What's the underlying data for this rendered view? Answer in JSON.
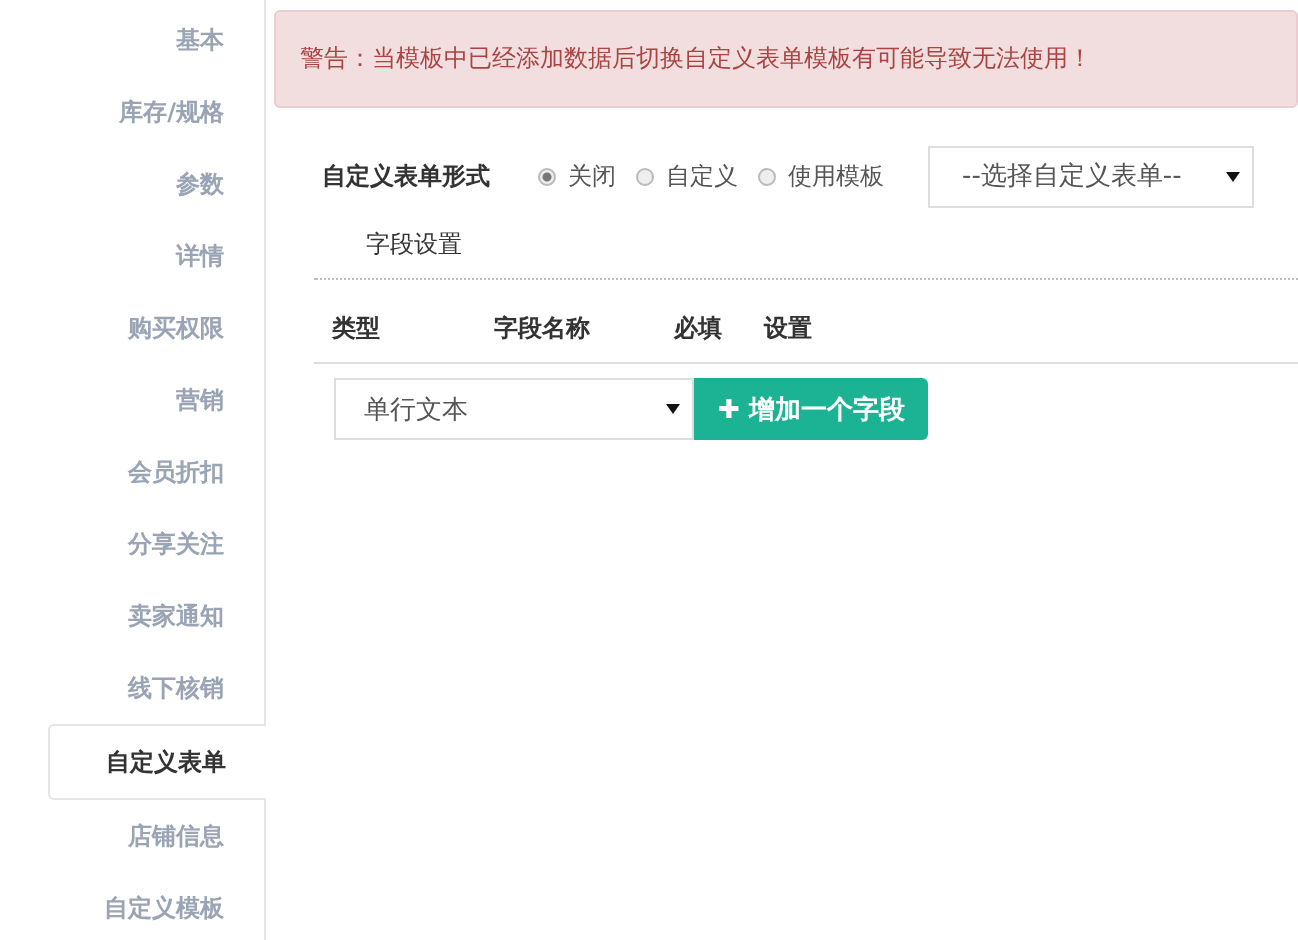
{
  "sidebar": {
    "items": [
      {
        "label": "基本",
        "selected": false
      },
      {
        "label": "库存/规格",
        "selected": false
      },
      {
        "label": "参数",
        "selected": false
      },
      {
        "label": "详情",
        "selected": false
      },
      {
        "label": "购买权限",
        "selected": false
      },
      {
        "label": "营销",
        "selected": false
      },
      {
        "label": "会员折扣",
        "selected": false
      },
      {
        "label": "分享关注",
        "selected": false
      },
      {
        "label": "卖家通知",
        "selected": false
      },
      {
        "label": "线下核销",
        "selected": false
      },
      {
        "label": "自定义表单",
        "selected": true
      },
      {
        "label": "店铺信息",
        "selected": false
      },
      {
        "label": "自定义模板",
        "selected": false
      }
    ]
  },
  "alert": {
    "text": "警告：当模板中已经添加数据后切换自定义表单模板有可能导致无法使用！"
  },
  "form_mode": {
    "label": "自定义表单形式",
    "options": [
      {
        "label": "关闭",
        "selected": true
      },
      {
        "label": "自定义",
        "selected": false
      },
      {
        "label": "使用模板",
        "selected": false
      }
    ],
    "template_select": {
      "value": "--选择自定义表单--"
    }
  },
  "section_tab": "字段设置",
  "table": {
    "columns": [
      "类型",
      "字段名称",
      "必填",
      "设置"
    ]
  },
  "add_row": {
    "type_select": "单行文本",
    "add_button": "✚ 增加一个字段"
  }
}
